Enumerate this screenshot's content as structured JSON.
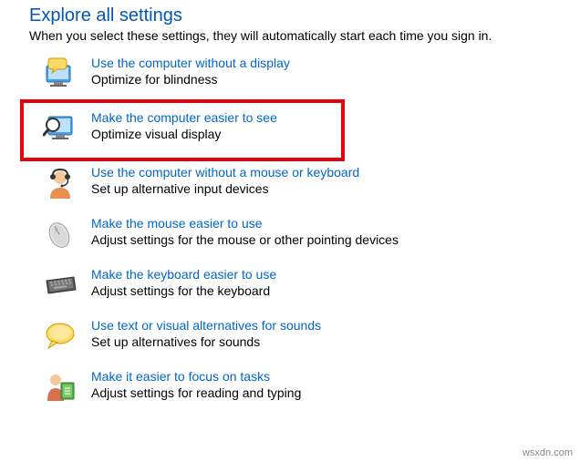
{
  "header": {
    "title": "Explore all settings",
    "subtitle": "When you select these settings, they will automatically start each time you sign in."
  },
  "options": [
    {
      "icon": "monitor-speech-icon",
      "link": "Use the computer without a display",
      "desc": "Optimize for blindness",
      "highlighted": false
    },
    {
      "icon": "monitor-magnifier-icon",
      "link": "Make the computer easier to see",
      "desc": "Optimize visual display",
      "highlighted": true
    },
    {
      "icon": "person-headset-icon",
      "link": "Use the computer without a mouse or keyboard",
      "desc": "Set up alternative input devices",
      "highlighted": false
    },
    {
      "icon": "mouse-icon",
      "link": "Make the mouse easier to use",
      "desc": "Adjust settings for the mouse or other pointing devices",
      "highlighted": false
    },
    {
      "icon": "keyboard-icon",
      "link": "Make the keyboard easier to use",
      "desc": "Adjust settings for the keyboard",
      "highlighted": false
    },
    {
      "icon": "speech-bubble-icon",
      "link": "Use text or visual alternatives for sounds",
      "desc": "Set up alternatives for sounds",
      "highlighted": false
    },
    {
      "icon": "person-book-icon",
      "link": "Make it easier to focus on tasks",
      "desc": "Adjust settings for reading and typing",
      "highlighted": false
    }
  ],
  "watermark": "wsxdn.com"
}
